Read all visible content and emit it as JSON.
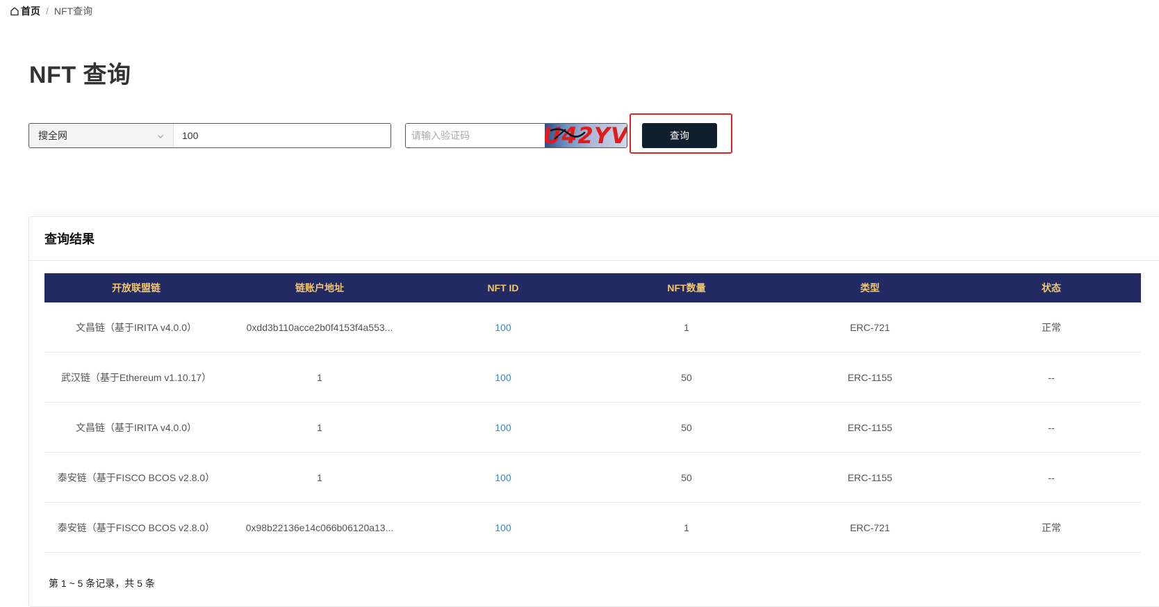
{
  "breadcrumb": {
    "home": "首页",
    "separator": "/",
    "current": "NFT查询",
    "icon": "home-icon"
  },
  "page_title": "NFT 查询",
  "search": {
    "scope_selected": "搜全网",
    "keyword_value": "100",
    "captcha_placeholder": "请输入验证码",
    "captcha_text": "U42YV",
    "query_button": "查询"
  },
  "results": {
    "title": "查询结果",
    "columns": [
      "开放联盟链",
      "链账户地址",
      "NFT ID",
      "NFT数量",
      "类型",
      "状态"
    ],
    "rows": [
      [
        "文昌链（基于IRITA v4.0.0）",
        "0xdd3b110acce2b0f4153f4a553...",
        "100",
        "1",
        "ERC-721",
        "正常"
      ],
      [
        "武汉链（基于Ethereum v1.10.17）",
        "1",
        "100",
        "50",
        "ERC-1155",
        "--"
      ],
      [
        "文昌链（基于IRITA v4.0.0）",
        "1",
        "100",
        "50",
        "ERC-1155",
        "--"
      ],
      [
        "泰安链（基于FISCO BCOS v2.8.0）",
        "1",
        "100",
        "50",
        "ERC-1155",
        "--"
      ],
      [
        "泰安链（基于FISCO BCOS v2.8.0）",
        "0x98b22136e14c066b06120a13...",
        "100",
        "1",
        "ERC-721",
        "正常"
      ]
    ],
    "summary": "第 1 ~ 5 条记录，共 5 条"
  },
  "colors": {
    "header_bg": "#212a62",
    "header_text": "#f3c66b",
    "link": "#2f86d6",
    "button_bg": "#0f1f2e",
    "highlight": "#e02424"
  }
}
